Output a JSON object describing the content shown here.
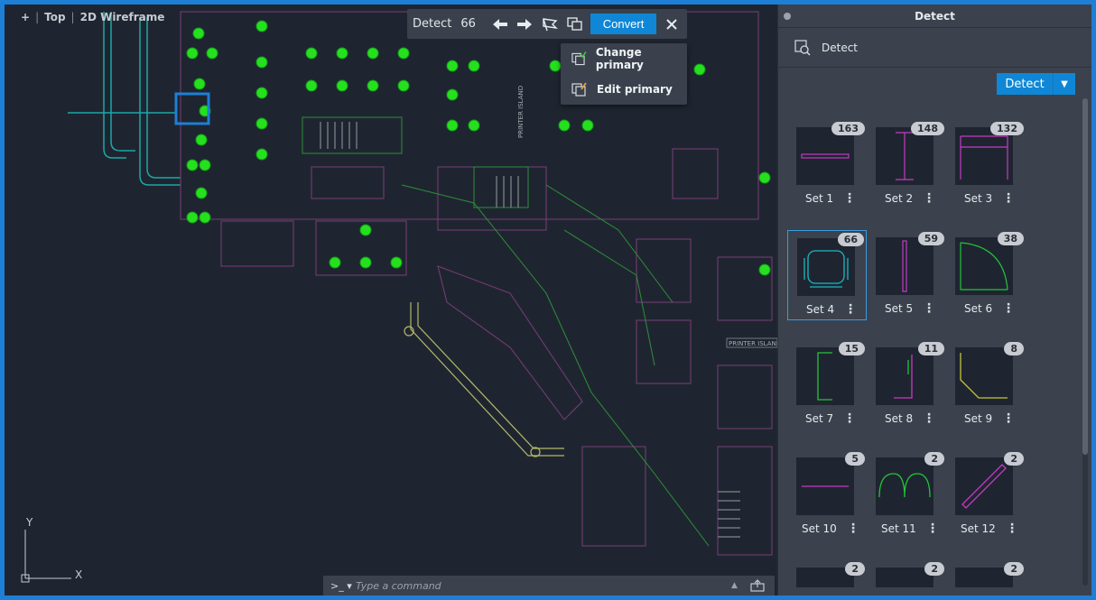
{
  "viewport": {
    "plus": "+",
    "view_name": "Top",
    "visual_style": "2D Wireframe"
  },
  "detect_toolbar": {
    "label": "Detect",
    "count": "66",
    "convert_label": "Convert",
    "icons": [
      "arrow-left-icon",
      "arrow-right-icon",
      "flag-icon",
      "copy-layers-icon",
      "close-icon"
    ]
  },
  "primary_menu": {
    "items": [
      {
        "label": "Change primary",
        "icon": "change-primary-icon"
      },
      {
        "label": "Edit primary",
        "icon": "edit-primary-icon"
      }
    ]
  },
  "palette": {
    "title": "Detect",
    "header_label": "Detect",
    "detect_button": "Detect",
    "sets": [
      {
        "label": "Set 1",
        "count": "163"
      },
      {
        "label": "Set 2",
        "count": "148"
      },
      {
        "label": "Set 3",
        "count": "132"
      },
      {
        "label": "Set 4",
        "count": "66"
      },
      {
        "label": "Set 5",
        "count": "59"
      },
      {
        "label": "Set 6",
        "count": "38"
      },
      {
        "label": "Set 7",
        "count": "15"
      },
      {
        "label": "Set 8",
        "count": "11"
      },
      {
        "label": "Set 9",
        "count": "8"
      },
      {
        "label": "Set 10",
        "count": "5"
      },
      {
        "label": "Set 11",
        "count": "2"
      },
      {
        "label": "Set 12",
        "count": "2"
      },
      {
        "label": "",
        "count": "2"
      },
      {
        "label": "",
        "count": "2"
      },
      {
        "label": "",
        "count": "2"
      }
    ]
  },
  "drawing": {
    "labels": [
      "PRINTER ISLAND",
      "PRINTER ISLAND"
    ]
  },
  "ucs": {
    "x_label": "X",
    "y_label": "Y"
  },
  "command_line": {
    "prompt": ">_",
    "placeholder": "Type a command"
  },
  "colors": {
    "accent": "#0f87d6",
    "highlight_green": "#27e01d",
    "selection_blue": "#1d7fd6"
  }
}
